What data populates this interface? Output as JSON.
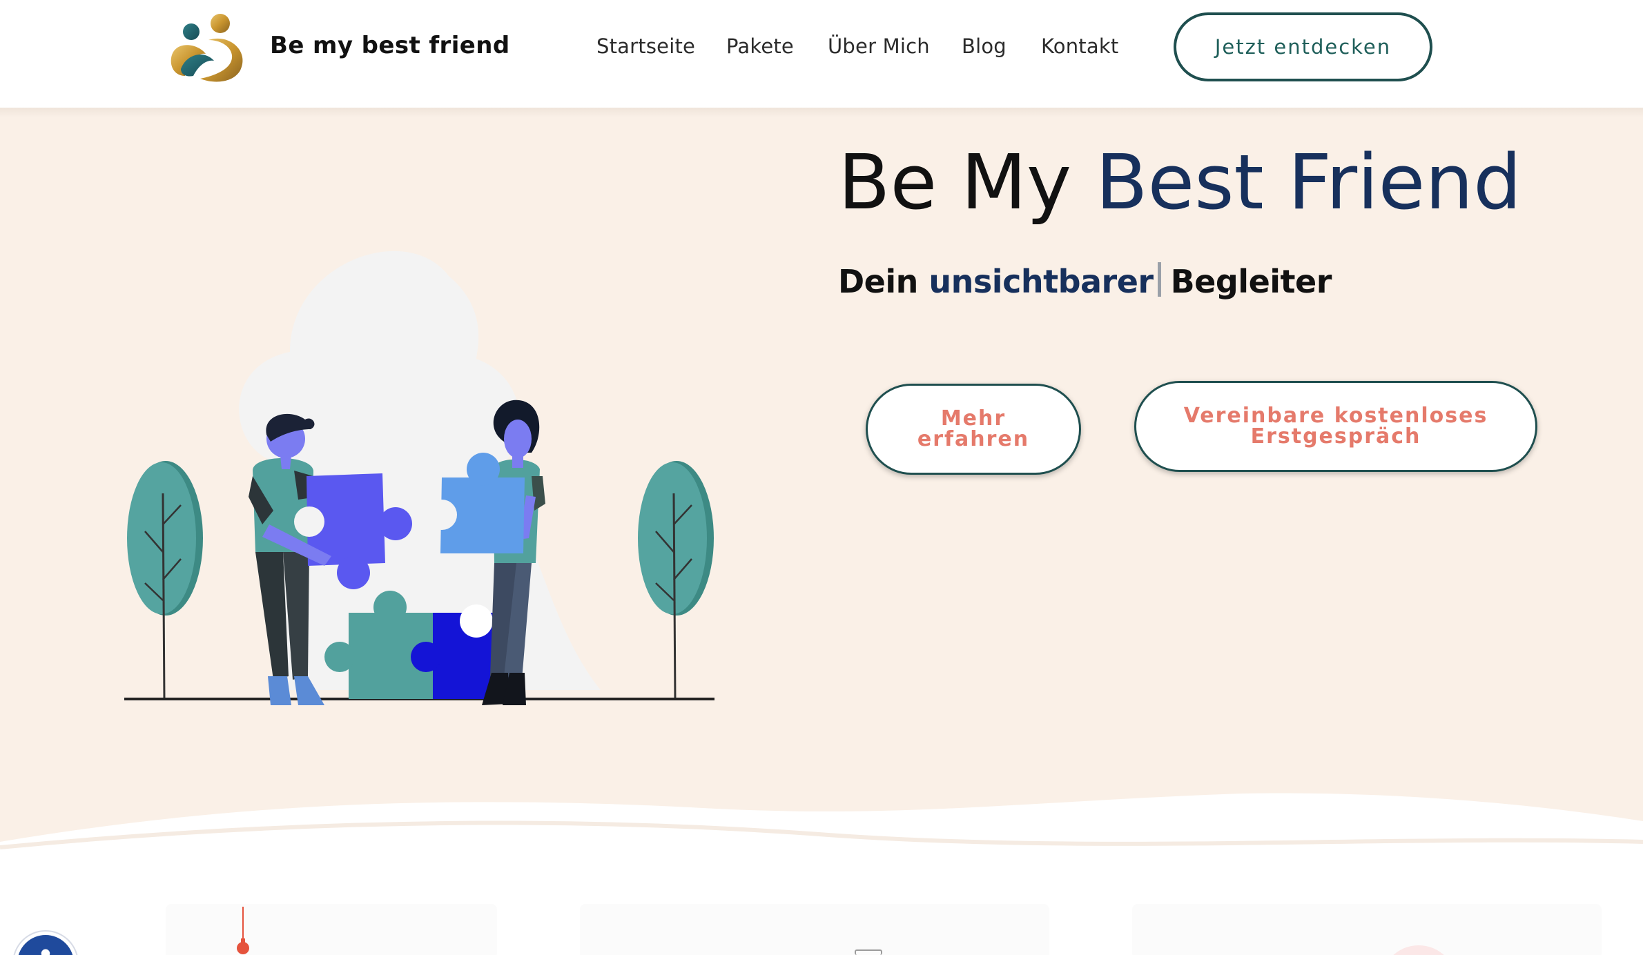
{
  "header": {
    "brand": "Be my best friend",
    "nav": [
      {
        "label": "Startseite"
      },
      {
        "label": "Pakete"
      },
      {
        "label": "Über Mich"
      },
      {
        "label": "Blog"
      },
      {
        "label": "Kontakt"
      }
    ],
    "cta_label": "Jetzt entdecken"
  },
  "hero": {
    "title_part1": "Be My ",
    "title_part2": "Best Friend",
    "subtitle_prefix": "Dein ",
    "subtitle_typed": "unsichtbarer",
    "subtitle_suffix": "Begleiter",
    "button_more": "Mehr erfahren",
    "button_call": "Vereinbare kostenloses Erstgespräch"
  },
  "colors": {
    "hero_bg": "#faf0e7",
    "accent_navy": "#17305c",
    "button_text": "#e57a6b",
    "teal": "#1f4f4f"
  },
  "icons": [
    "logo-icon",
    "puzzle-illustration",
    "accessibility-icon",
    "tv-tower-icon"
  ]
}
